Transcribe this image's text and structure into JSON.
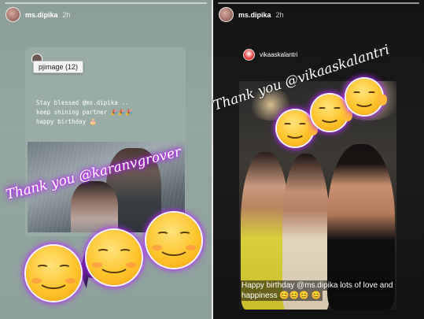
{
  "left_story": {
    "username": "ms.dipika",
    "time": "2h",
    "tooltip": "pjimage (12)",
    "caption_lines": [
      "Stay blessed @ms.dipika ..",
      "keep shining partner 🎉🎉🎉",
      "happy birthday 🎂"
    ],
    "sticker_text": "Thank you @karanvgrover"
  },
  "right_story": {
    "username": "ms.dipika",
    "time": "2h",
    "repost_username": "vikaaskalantri",
    "sticker_text": "Thank you @vikaaskalantri",
    "caption": "Happy birthday @ms.dipika lots of love and happiness 😊😊😊 😊"
  },
  "colors": {
    "left_bg": "#8e9f9a",
    "right_bg": "#161616",
    "glow": "#b617ff",
    "emoji_yellow": "#ffc42c"
  }
}
